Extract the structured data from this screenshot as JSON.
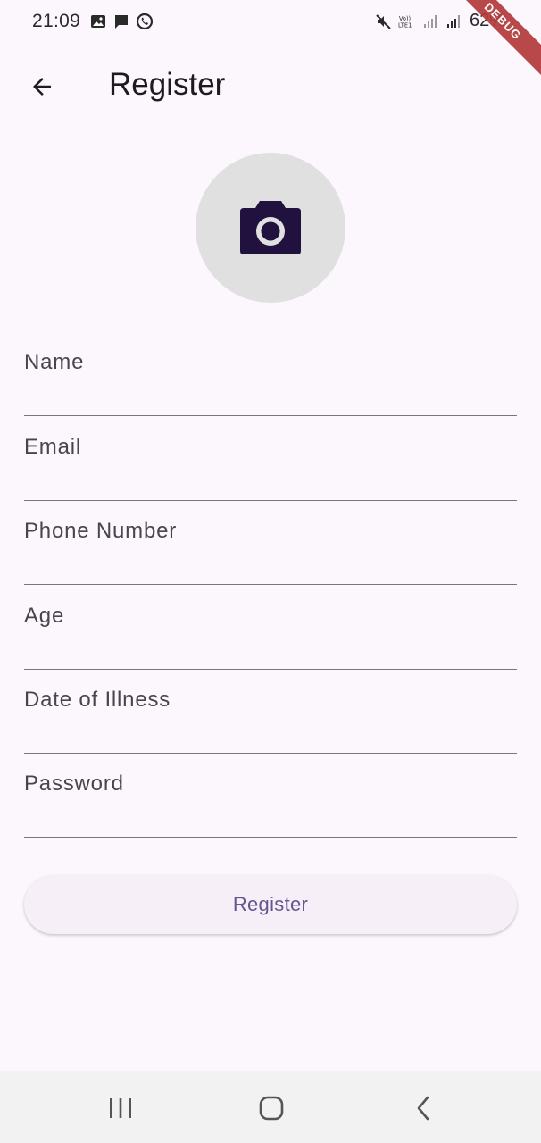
{
  "status_bar": {
    "time": "21:09",
    "battery": "62%",
    "icons_left": [
      "image-icon",
      "message-icon",
      "whatsapp-icon"
    ],
    "icons_right": [
      "mute-icon",
      "volte-icon",
      "signal-icon",
      "signal-icon-2",
      "battery-icon"
    ]
  },
  "debug_banner": "DEBUG",
  "app_bar": {
    "title": "Register"
  },
  "form": {
    "fields": [
      {
        "label": "Name"
      },
      {
        "label": "Email"
      },
      {
        "label": "Phone Number"
      },
      {
        "label": "Age"
      },
      {
        "label": "Date of Illness"
      },
      {
        "label": "Password"
      }
    ],
    "submit_label": "Register"
  },
  "colors": {
    "background": "#fcf7fd",
    "primary": "#65558f",
    "camera_icon": "#20113f",
    "avatar_bg": "#e0e0e0",
    "debug": "#b33a3a"
  }
}
